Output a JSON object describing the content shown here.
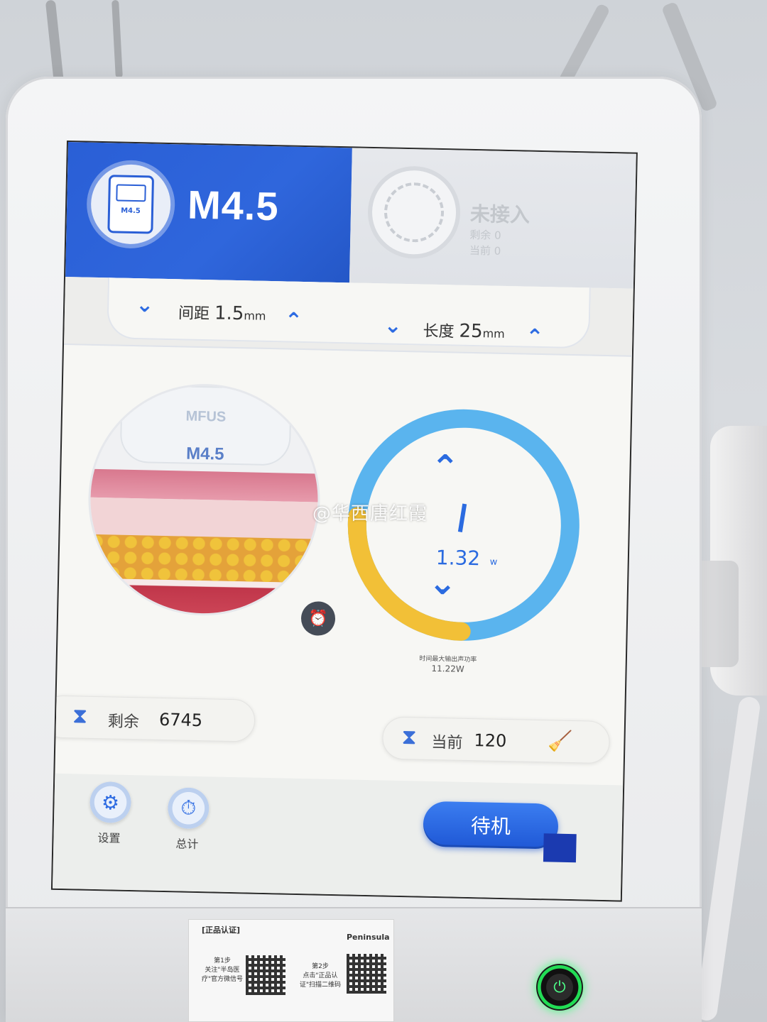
{
  "header": {
    "probe_title": "M4.5",
    "probe_icon_label": "M4.5",
    "connection_status": "未接入",
    "remaining_line": "剩余 0",
    "current_line": "当前 0"
  },
  "params": {
    "spacing_label": "间距",
    "spacing_value": "1.5",
    "spacing_unit": "mm",
    "length_label": "长度",
    "length_value": "25",
    "length_unit": "mm"
  },
  "illustration": {
    "brand_text": "MFUS",
    "probe_text": "M4.5"
  },
  "power_gauge": {
    "value": "1.32",
    "unit": "w",
    "caption": "时间最大输出声功率",
    "max_value_text": "11.22W",
    "level_fraction": 0.118,
    "track_color": "#5ab4ee",
    "fill_color": "#f2c037"
  },
  "counters": {
    "remaining_label": "剩余",
    "remaining_value": "6745",
    "current_label": "当前",
    "current_value": "120"
  },
  "bottom": {
    "settings_label": "设置",
    "total_label": "总计",
    "standby_label": "待机"
  },
  "icons": {
    "hourglass": "hourglass-icon",
    "alarm": "alarm-clock-icon",
    "broom": "broom-icon",
    "settings": "gear-icon",
    "stopwatch": "stopwatch-icon"
  },
  "sticker": {
    "title": "[正品认证]",
    "brand": "Peninsula",
    "step1": "第1步",
    "step1_text": "关注\"半岛医疗\"官方微信号",
    "step2": "第2步",
    "step2_text": "点击\"正品认证\"扫描二维码"
  },
  "watermark": "@华西唐红霞"
}
